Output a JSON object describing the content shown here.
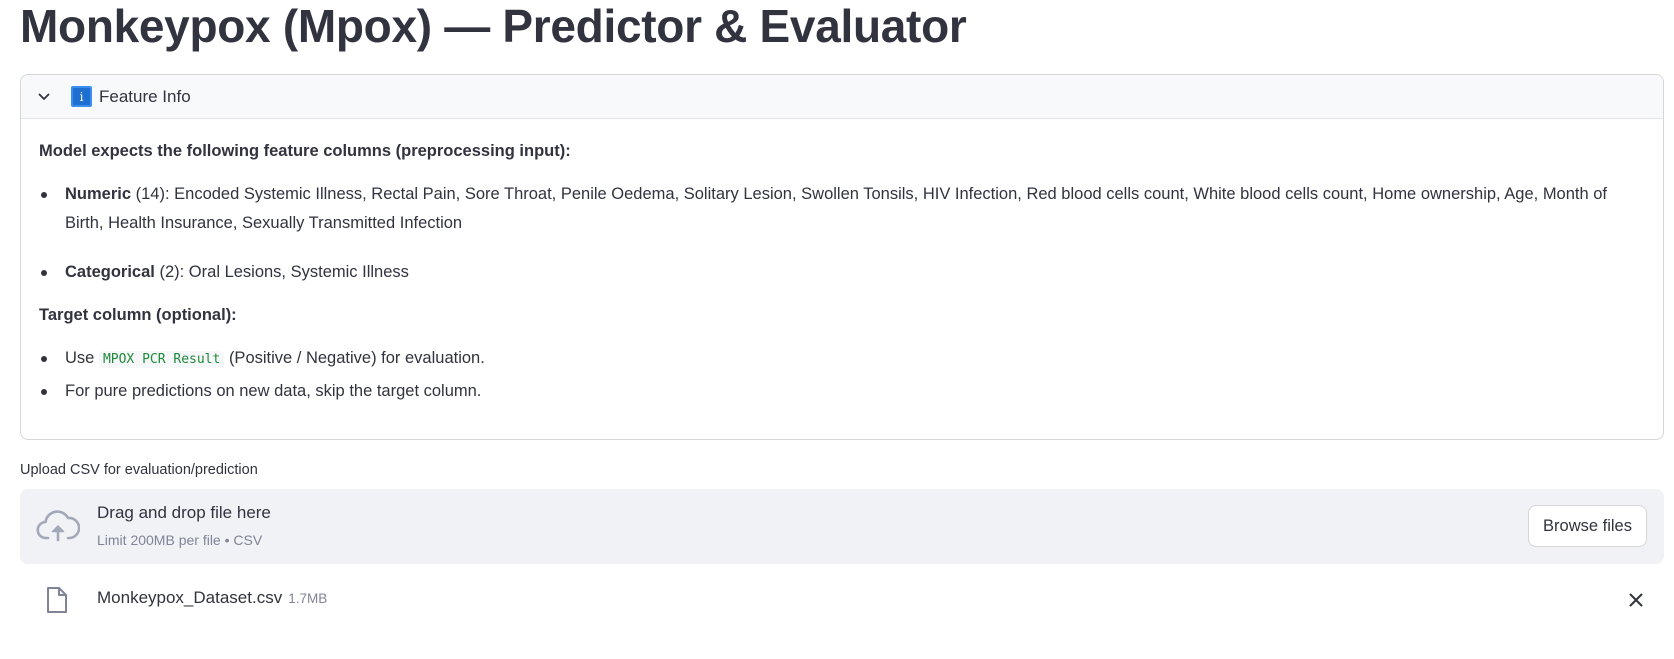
{
  "page": {
    "title": "Monkeypox (Mpox) — Predictor & Evaluator"
  },
  "expander": {
    "label": "Feature Info",
    "icon": "info-icon",
    "chevron_icon": "chevron-down-icon",
    "heading_features": "Model expects the following feature columns (preprocessing input):",
    "numeric": {
      "label": "Numeric",
      "count": "(14)",
      "items": ": Encoded Systemic Illness, Rectal Pain, Sore Throat, Penile Oedema, Solitary Lesion, Swollen Tonsils, HIV Infection, Red blood cells count, White blood cells count, Home ownership, Age, Month of Birth, Health Insurance, Sexually Transmitted Infection"
    },
    "categorical": {
      "label": "Categorical",
      "count": "(2)",
      "items": ": Oral Lesions, Systemic Illness"
    },
    "heading_target": "Target column (optional):",
    "target_items": {
      "use_prefix": "Use",
      "target_code": "MPOX PCR Result",
      "use_suffix": "(Positive / Negative) for evaluation.",
      "skip_text": "For pure predictions on new data, skip the target column."
    }
  },
  "uploader": {
    "label": "Upload CSV for evaluation/prediction",
    "drop_title": "Drag and drop file here",
    "drop_limit": "Limit 200MB per file • CSV",
    "browse_label": "Browse files",
    "cloud_icon": "cloud-upload-icon"
  },
  "uploaded_file": {
    "name": "Monkeypox_Dataset.csv",
    "size": "1.7MB",
    "file_icon": "file-icon",
    "remove_icon": "close-icon"
  },
  "colors": {
    "text": "#31333f",
    "muted": "#808495",
    "dropzone_bg": "#f0f2f6",
    "border": "#d6d6d9",
    "code_text": "#1f8a3b",
    "info_icon_bg": "#1f6fd0"
  }
}
